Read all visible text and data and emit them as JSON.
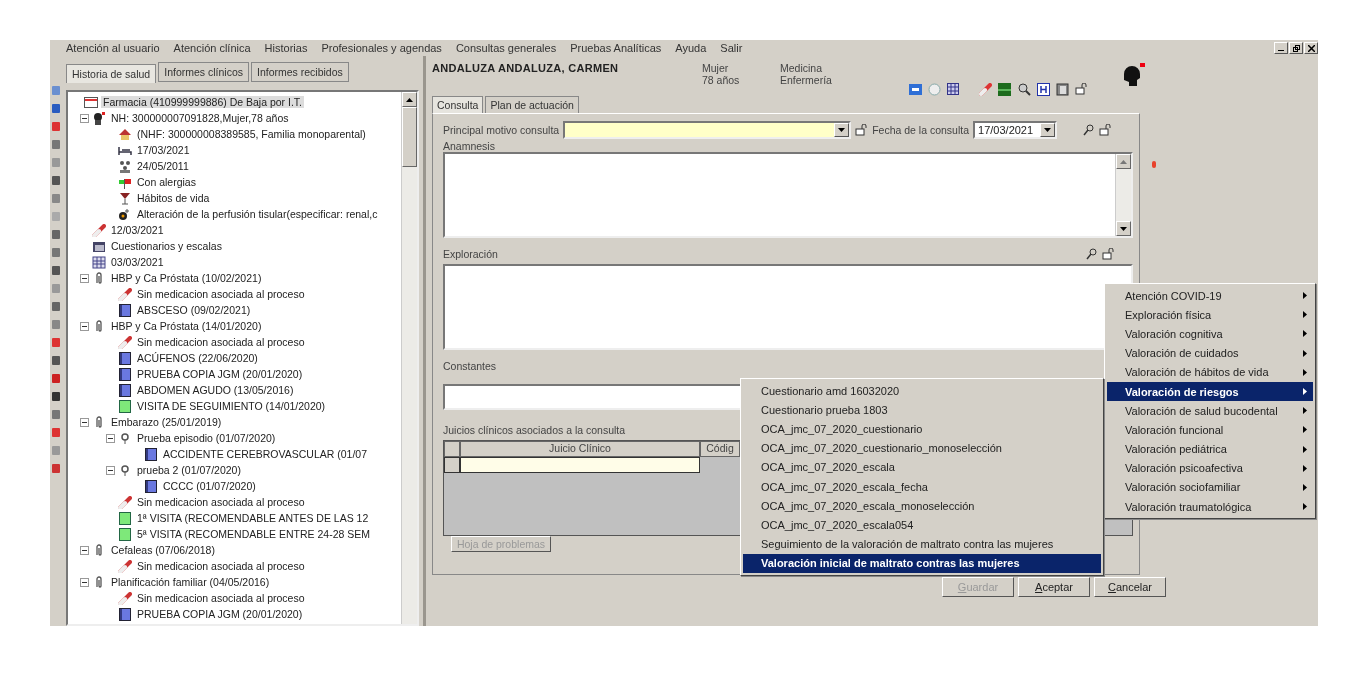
{
  "menu_bar": [
    "Atención al usuario",
    "Atención clínica",
    "Historias",
    "Profesionales y agendas",
    "Consultas generales",
    "Pruebas Analíticas",
    "Ayuda",
    "Salir"
  ],
  "left_tabs": [
    {
      "label": "Historia de salud",
      "selected": true
    },
    {
      "label": "Informes clínicos",
      "selected": false
    },
    {
      "label": "Informes recibidos",
      "selected": false
    }
  ],
  "tree": [
    {
      "label": "Farmacia (410999999886) De Baja por I.T.",
      "kind": "card",
      "selected": true,
      "children": [
        {
          "label": "NH: 300000007091828,Mujer,78 años",
          "kind": "person",
          "selected": false,
          "expanded": true,
          "children": [
            {
              "label": "(NHF: 300000008389585, Familia monoparental)",
              "kind": "house",
              "selected": false
            },
            {
              "label": "17/03/2021",
              "kind": "bed",
              "selected": false
            },
            {
              "label": "24/05/2011",
              "kind": "family",
              "selected": false
            },
            {
              "label": "Con alergias",
              "kind": "allergy",
              "selected": false
            },
            {
              "label": "Hábitos de vida",
              "kind": "habits",
              "selected": false
            },
            {
              "label": "Alteración de la perfusión tisular(especificar: renal,c",
              "kind": "alteration",
              "selected": false
            }
          ]
        },
        {
          "label": "12/03/2021",
          "kind": "pill",
          "selected": false
        },
        {
          "label": "Cuestionarios y escalas",
          "kind": "questionnaire",
          "selected": false
        },
        {
          "label": "03/03/2021",
          "kind": "calendar",
          "selected": false
        },
        {
          "label": "HBP y Ca Próstata (10/02/2021)",
          "kind": "clip",
          "selected": false,
          "expanded": true,
          "children": [
            {
              "label": "Sin medicacion asociada al proceso",
              "kind": "pill",
              "selected": false
            },
            {
              "label": "ABSCESO (09/02/2021)",
              "kind": "blue",
              "selected": false
            }
          ]
        },
        {
          "label": "HBP y Ca Próstata (14/01/2020)",
          "kind": "clip",
          "selected": false,
          "expanded": true,
          "children": [
            {
              "label": "Sin medicacion asociada al proceso",
              "kind": "pill",
              "selected": false
            },
            {
              "label": "ACÚFENOS (22/06/2020)",
              "kind": "blue",
              "selected": false
            },
            {
              "label": "PRUEBA COPIA JGM (20/01/2020)",
              "kind": "blue",
              "selected": false
            },
            {
              "label": "ABDOMEN AGUDO (13/05/2016)",
              "kind": "blue",
              "selected": false
            },
            {
              "label": "VISITA DE SEGUIMIENTO (14/01/2020)",
              "kind": "green",
              "selected": false
            }
          ]
        },
        {
          "label": "Embarazo (25/01/2019)",
          "kind": "clip",
          "selected": false,
          "expanded": true,
          "children": [
            {
              "label": "Prueba episodio (01/07/2020)",
              "kind": "episode",
              "selected": false,
              "expanded": true,
              "children": [
                {
                  "label": "ACCIDENTE CEREBROVASCULAR (01/07",
                  "kind": "blue",
                  "selected": false
                }
              ]
            },
            {
              "label": "prueba 2 (01/07/2020)",
              "kind": "episode",
              "selected": false,
              "expanded": true,
              "children": [
                {
                  "label": "CCCC (01/07/2020)",
                  "kind": "blue",
                  "selected": false
                }
              ]
            },
            {
              "label": "Sin medicacion asociada al proceso",
              "kind": "pill",
              "selected": false
            },
            {
              "label": "1ª VISITA (RECOMENDABLE ANTES DE LAS 12",
              "kind": "green",
              "selected": false
            },
            {
              "label": "5ª VISITA (RECOMENDABLE ENTRE 24-28 SEM",
              "kind": "green",
              "selected": false
            }
          ]
        },
        {
          "label": "Cefaleas (07/06/2018)",
          "kind": "clip",
          "selected": false,
          "expanded": true,
          "children": [
            {
              "label": "Sin medicacion asociada al proceso",
              "kind": "pill",
              "selected": false
            }
          ]
        },
        {
          "label": "Planificación familiar (04/05/2016)",
          "kind": "clip",
          "selected": false,
          "expanded": true,
          "children": [
            {
              "label": "Sin medicacion asociada al proceso",
              "kind": "pill",
              "selected": false
            },
            {
              "label": "PRUEBA COPIA JGM (20/01/2020)",
              "kind": "blue",
              "selected": false
            }
          ]
        }
      ]
    }
  ],
  "patient": {
    "name": "ANDALUZA ANDALUZA, CARMEN",
    "sex": "Mujer",
    "age": "78 años",
    "roles": [
      "Medicina",
      "Enfermería"
    ]
  },
  "form_tabs": [
    {
      "label": "Consulta",
      "selected": true
    },
    {
      "label": "Plan de actuación",
      "selected": false
    }
  ],
  "form": {
    "motivo_label": "Principal motivo consulta",
    "fecha_label": "Fecha de la consulta",
    "fecha_value": "17/03/2021",
    "anamnesis_label": "Anamnesis",
    "exploracion_label": "Exploración",
    "constantes_label": "Constantes",
    "juicios_label": "Juicios clínicos asociados a la consulta"
  },
  "table": {
    "columns": [
      "Juicio Clínico",
      "Códig"
    ]
  },
  "problems_button": {
    "label": "Hoja de problemas",
    "disabled": true
  },
  "buttons": [
    {
      "label": "Guardar",
      "disabled": true
    },
    {
      "label": "Aceptar",
      "disabled": false
    },
    {
      "label": "Cancelar",
      "disabled": false
    }
  ],
  "menu": [
    {
      "label": "Atención COVID-19",
      "selected": false
    },
    {
      "label": "Exploración física",
      "selected": false
    },
    {
      "label": "Valoración cognitiva",
      "selected": false
    },
    {
      "label": "Valoración de cuidados",
      "selected": false
    },
    {
      "label": "Valoración de hábitos de vida",
      "selected": false
    },
    {
      "label": "Valoración de riesgos",
      "selected": true
    },
    {
      "label": "Valoración de salud bucodental",
      "selected": false
    },
    {
      "label": "Valoración funcional",
      "selected": false
    },
    {
      "label": "Valoración pediátrica",
      "selected": false
    },
    {
      "label": "Valoración psicoafectiva",
      "selected": false
    },
    {
      "label": "Valoración sociofamiliar",
      "selected": false
    },
    {
      "label": "Valoración traumatológica",
      "selected": false
    }
  ],
  "submenu": [
    {
      "label": "Cuestionario amd 16032020",
      "selected": false
    },
    {
      "label": "Cuestionario prueba 1803",
      "selected": false
    },
    {
      "label": "OCA_jmc_07_2020_cuestionario",
      "selected": false
    },
    {
      "label": "OCA_jmc_07_2020_cuestionario_monoselección",
      "selected": false
    },
    {
      "label": "OCA_jmc_07_2020_escala",
      "selected": false
    },
    {
      "label": "OCA_jmc_07_2020_escala_fecha",
      "selected": false
    },
    {
      "label": "OCA_jmc_07_2020_escala_monoselección",
      "selected": false
    },
    {
      "label": "OCA_jmc_07_2020_escala054",
      "selected": false
    },
    {
      "label": "Seguimiento de la valoración de maltrato contra las mujeres",
      "selected": false
    },
    {
      "label": "Valoración inicial de maltrato contras las mujeres",
      "selected": true
    }
  ]
}
